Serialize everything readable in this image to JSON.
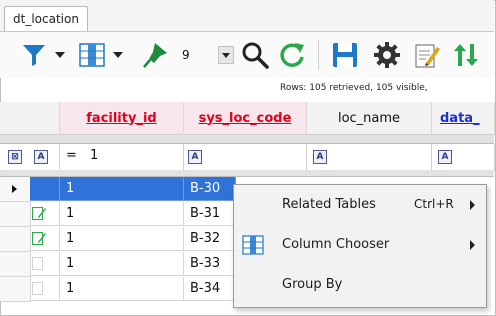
{
  "tab": {
    "label": "dt_location"
  },
  "toolbar": {
    "filter_icon": "funnel-icon",
    "columns_icon": "column-chooser-icon",
    "pin_icon": "pin-icon",
    "count_value": "9",
    "search_icon": "search-icon",
    "refresh_icon": "refresh-icon",
    "save_icon": "save-icon",
    "settings_icon": "gear-icon",
    "edit_icon": "edit-icon",
    "sort_icon": "sort-icon",
    "accent": "#1f78c8"
  },
  "status": {
    "text": "Rows: 105 retrieved, 105 visible,"
  },
  "grid": {
    "columns": [
      "facility_id",
      "sys_loc_code",
      "loc_name",
      "data_"
    ],
    "filter": {
      "operator": "=",
      "value": "1"
    },
    "rows": [
      {
        "facility_id": "1",
        "sys_loc_code": "B-30",
        "selected": true
      },
      {
        "facility_id": "1",
        "sys_loc_code": "B-31",
        "selected": false
      },
      {
        "facility_id": "1",
        "sys_loc_code": "B-32",
        "selected": false
      },
      {
        "facility_id": "1",
        "sys_loc_code": "B-33",
        "selected": false
      },
      {
        "facility_id": "1",
        "sys_loc_code": "B-34",
        "selected": false
      }
    ],
    "selection_color": "#2f73d8",
    "required_header_color": "#e0001b"
  },
  "context_menu": {
    "items": [
      {
        "label": "Related Tables",
        "shortcut": "Ctrl+R",
        "has_submenu": true
      },
      {
        "label": "Column Chooser",
        "shortcut": "",
        "has_submenu": true
      },
      {
        "label": "Group By",
        "shortcut": "",
        "has_submenu": false
      }
    ]
  }
}
